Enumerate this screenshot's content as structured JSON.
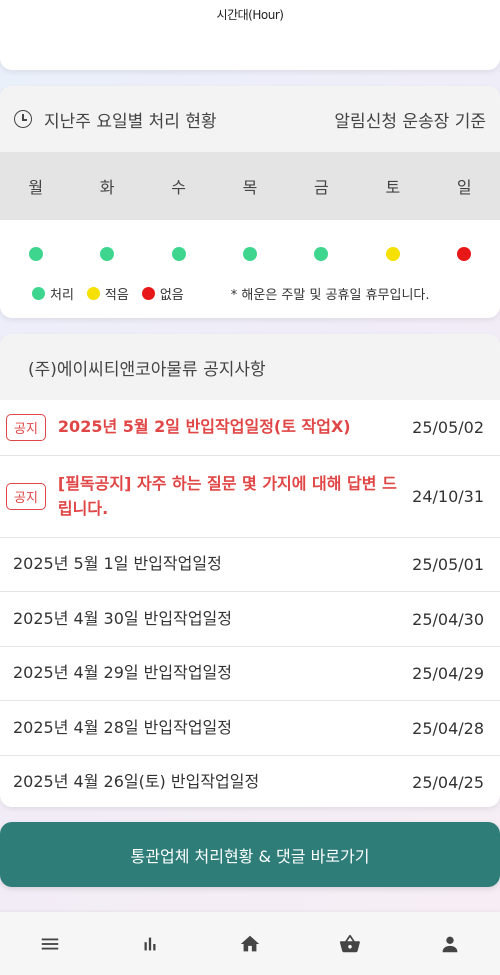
{
  "top_card": {
    "hour_label": "시간대(Hour)"
  },
  "weekly_status": {
    "title": "지난주 요일별 처리 현황",
    "basis": "알림신청 운송장 기준",
    "days": [
      {
        "label": "월",
        "status": "처리",
        "color": "#3ed68f"
      },
      {
        "label": "화",
        "status": "처리",
        "color": "#3ed68f"
      },
      {
        "label": "수",
        "status": "처리",
        "color": "#3ed68f"
      },
      {
        "label": "목",
        "status": "처리",
        "color": "#3ed68f"
      },
      {
        "label": "금",
        "status": "처리",
        "color": "#3ed68f"
      },
      {
        "label": "토",
        "status": "적음",
        "color": "#f5e000"
      },
      {
        "label": "일",
        "status": "없음",
        "color": "#e81818"
      }
    ],
    "legend": [
      {
        "label": "처리",
        "color": "#3ed68f"
      },
      {
        "label": "적음",
        "color": "#f5e000"
      },
      {
        "label": "없음",
        "color": "#e81818"
      }
    ],
    "note": "* 해운은 주말 및 공휴일 휴무입니다."
  },
  "notices": {
    "title": "(주)에이씨티앤코아물류 공지사항",
    "badge_label": "공지",
    "items": [
      {
        "text": "2025년 5월 2일 반입작업일정(토 작업X)",
        "date": "25/05/02",
        "important": true
      },
      {
        "text": "[필독공지] 자주 하는 질문 몇 가지에 대해 답변 드립니다.",
        "date": "24/10/31",
        "important": true
      },
      {
        "text": "2025년 5월 1일 반입작업일정",
        "date": "25/05/01",
        "important": false
      },
      {
        "text": "2025년 4월 30일 반입작업일정",
        "date": "25/04/30",
        "important": false
      },
      {
        "text": "2025년 4월 29일 반입작업일정",
        "date": "25/04/29",
        "important": false
      },
      {
        "text": "2025년 4월 28일 반입작업일정",
        "date": "25/04/28",
        "important": false
      },
      {
        "text": "2025년 4월 26일(토) 반입작업일정",
        "date": "25/04/25",
        "important": false
      }
    ]
  },
  "cta": {
    "label": "통관업체 처리현황 & 댓글 바로가기"
  },
  "bottom_nav": {
    "items": [
      {
        "icon": "menu-icon"
      },
      {
        "icon": "bar-chart-icon"
      },
      {
        "icon": "home-icon"
      },
      {
        "icon": "basket-icon"
      },
      {
        "icon": "person-icon"
      }
    ]
  }
}
